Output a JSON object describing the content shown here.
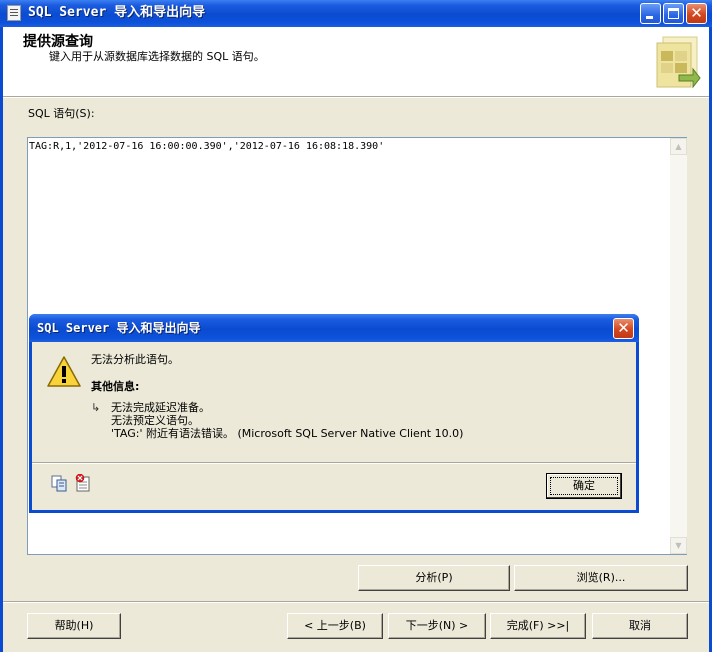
{
  "window": {
    "title": "SQL Server 导入和导出向导"
  },
  "header": {
    "title": "提供源查询",
    "subtitle": "键入用于从源数据库选择数据的 SQL 语句。"
  },
  "sql": {
    "label": "SQL 语句(S):",
    "text": "TAG:R,1,'2012-07-16 16:00:00.390','2012-07-16 16:08:18.390'"
  },
  "actions": {
    "parse_label": "分析(P)",
    "browse_label": "浏览(R)..."
  },
  "nav": {
    "help_label": "帮助(H)",
    "back_label": "< 上一步(B)",
    "next_label": "下一步(N) >",
    "finish_label": "完成(F) >>|",
    "cancel_label": "取消"
  },
  "dialog": {
    "title": "SQL Server 导入和导出向导",
    "message": "无法分析此语句。",
    "other_info_label": "其他信息:",
    "details": [
      "无法完成延迟准备。",
      "无法预定义语句。",
      "'TAG:' 附近有语法错误。 (Microsoft SQL Server Native Client 10.0)"
    ],
    "ok_label": "确定",
    "icons": [
      "copy-icon",
      "details-icon",
      "warning-icon"
    ]
  }
}
